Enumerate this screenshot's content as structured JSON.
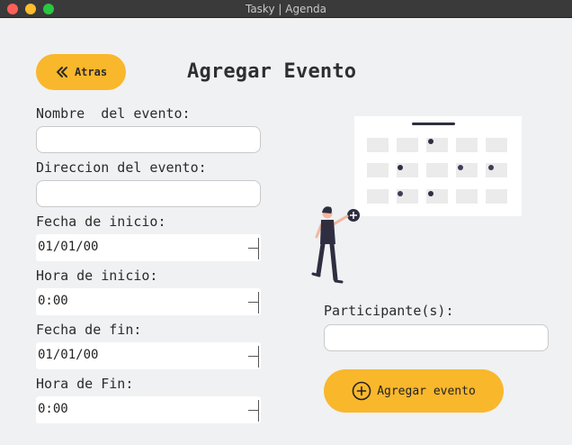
{
  "window": {
    "title": "Tasky | Agenda"
  },
  "header": {
    "back_label": "Atras",
    "title": "Agregar Evento"
  },
  "form": {
    "nombre_label": "Nombre  del evento:",
    "nombre_value": "",
    "direccion_label": "Direccion del evento:",
    "direccion_value": "",
    "fecha_inicio_label": "Fecha de inicio:",
    "fecha_inicio_value": "01/01/00",
    "hora_inicio_label": "Hora de inicio:",
    "hora_inicio_value": "0:00",
    "fecha_fin_label": "Fecha de fin:",
    "fecha_fin_value": "01/01/00",
    "hora_fin_label": "Hora de Fin:",
    "hora_fin_value": "0:00"
  },
  "participants": {
    "label": "Participante(s):",
    "value": ""
  },
  "actions": {
    "add_label": "Agregar evento"
  },
  "colors": {
    "accent": "#f9b72c",
    "background": "#f0f1f3",
    "text": "#2b2b2b"
  },
  "icons": {
    "back": "double-chevron-left-icon",
    "add": "plus-circle-icon"
  }
}
